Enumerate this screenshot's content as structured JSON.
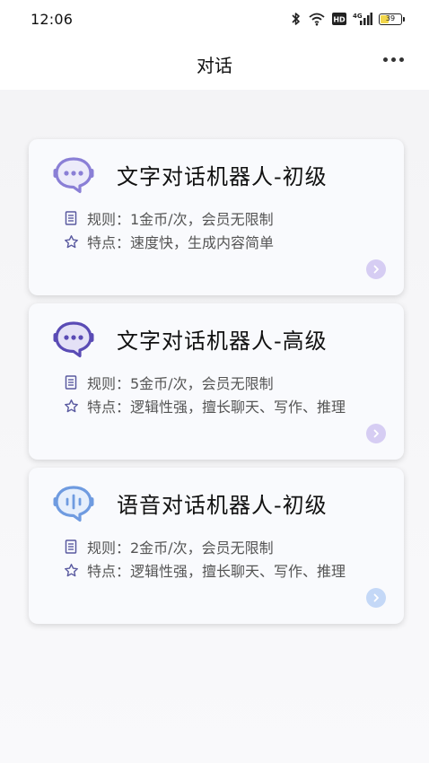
{
  "status_bar": {
    "time": "12:06",
    "network_label": "4G",
    "hd_label": "HD",
    "battery_level": "39"
  },
  "nav": {
    "title": "对话"
  },
  "cards": [
    {
      "title": "文字对话机器人-初级",
      "rule": "规则：1金币/次，会员无限制",
      "feature": "特点：速度快，生成内容简单",
      "icon": "chat-bubble-icon",
      "accent": "#8a7fd6",
      "arrow_color": "#d6cdf3"
    },
    {
      "title": "文字对话机器人-高级",
      "rule": "规则：5金币/次，会员无限制",
      "feature": "特点：逻辑性强，擅长聊天、写作、推理",
      "icon": "chat-bubble-icon",
      "accent": "#5a4bb5",
      "arrow_color": "#d6cdf3"
    },
    {
      "title": "语音对话机器人-初级",
      "rule": "规则：2金币/次，会员无限制",
      "feature": "特点：逻辑性强，擅长聊天、写作、推理",
      "icon": "voice-bubble-icon",
      "accent": "#6f9be0",
      "arrow_color": "#c4d8f7"
    }
  ]
}
